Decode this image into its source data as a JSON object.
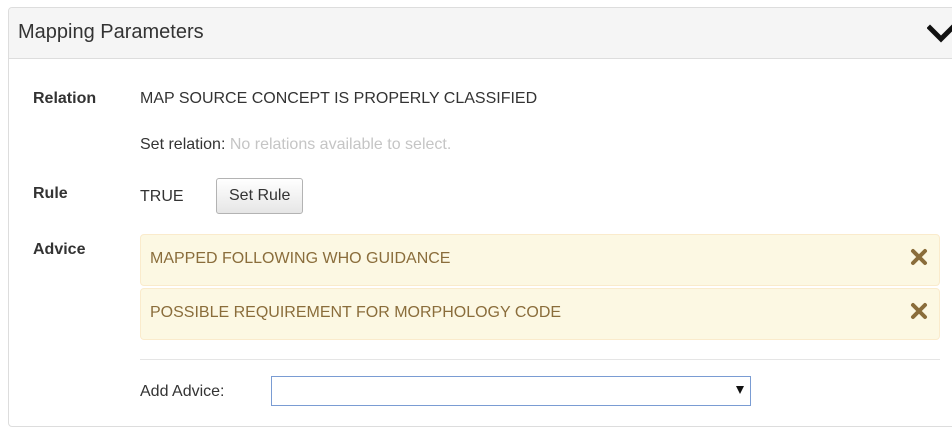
{
  "panel": {
    "title": "Mapping Parameters",
    "toggle_icon": "chevron-down-icon"
  },
  "relation": {
    "label": "Relation",
    "value": "MAP SOURCE CONCEPT IS PROPERLY CLASSIFIED",
    "set_label": "Set relation:",
    "empty_message": "No relations available to select."
  },
  "rule": {
    "label": "Rule",
    "value": "TRUE",
    "button_label": "Set Rule"
  },
  "advice": {
    "label": "Advice",
    "items": [
      {
        "text": "MAPPED FOLLOWING WHO GUIDANCE",
        "remove_icon": "remove-icon"
      },
      {
        "text": "POSSIBLE REQUIREMENT FOR MORPHOLOGY CODE",
        "remove_icon": "remove-icon"
      }
    ],
    "add_label": "Add Advice:",
    "add_selected": ""
  },
  "colors": {
    "heading_bg": "#f5f5f5",
    "advice_bg": "#fcf8e3",
    "advice_border": "#faebcc",
    "advice_text": "#8a6d3b",
    "muted_text": "#c5c5c5",
    "select_border": "#7a9cd3"
  }
}
